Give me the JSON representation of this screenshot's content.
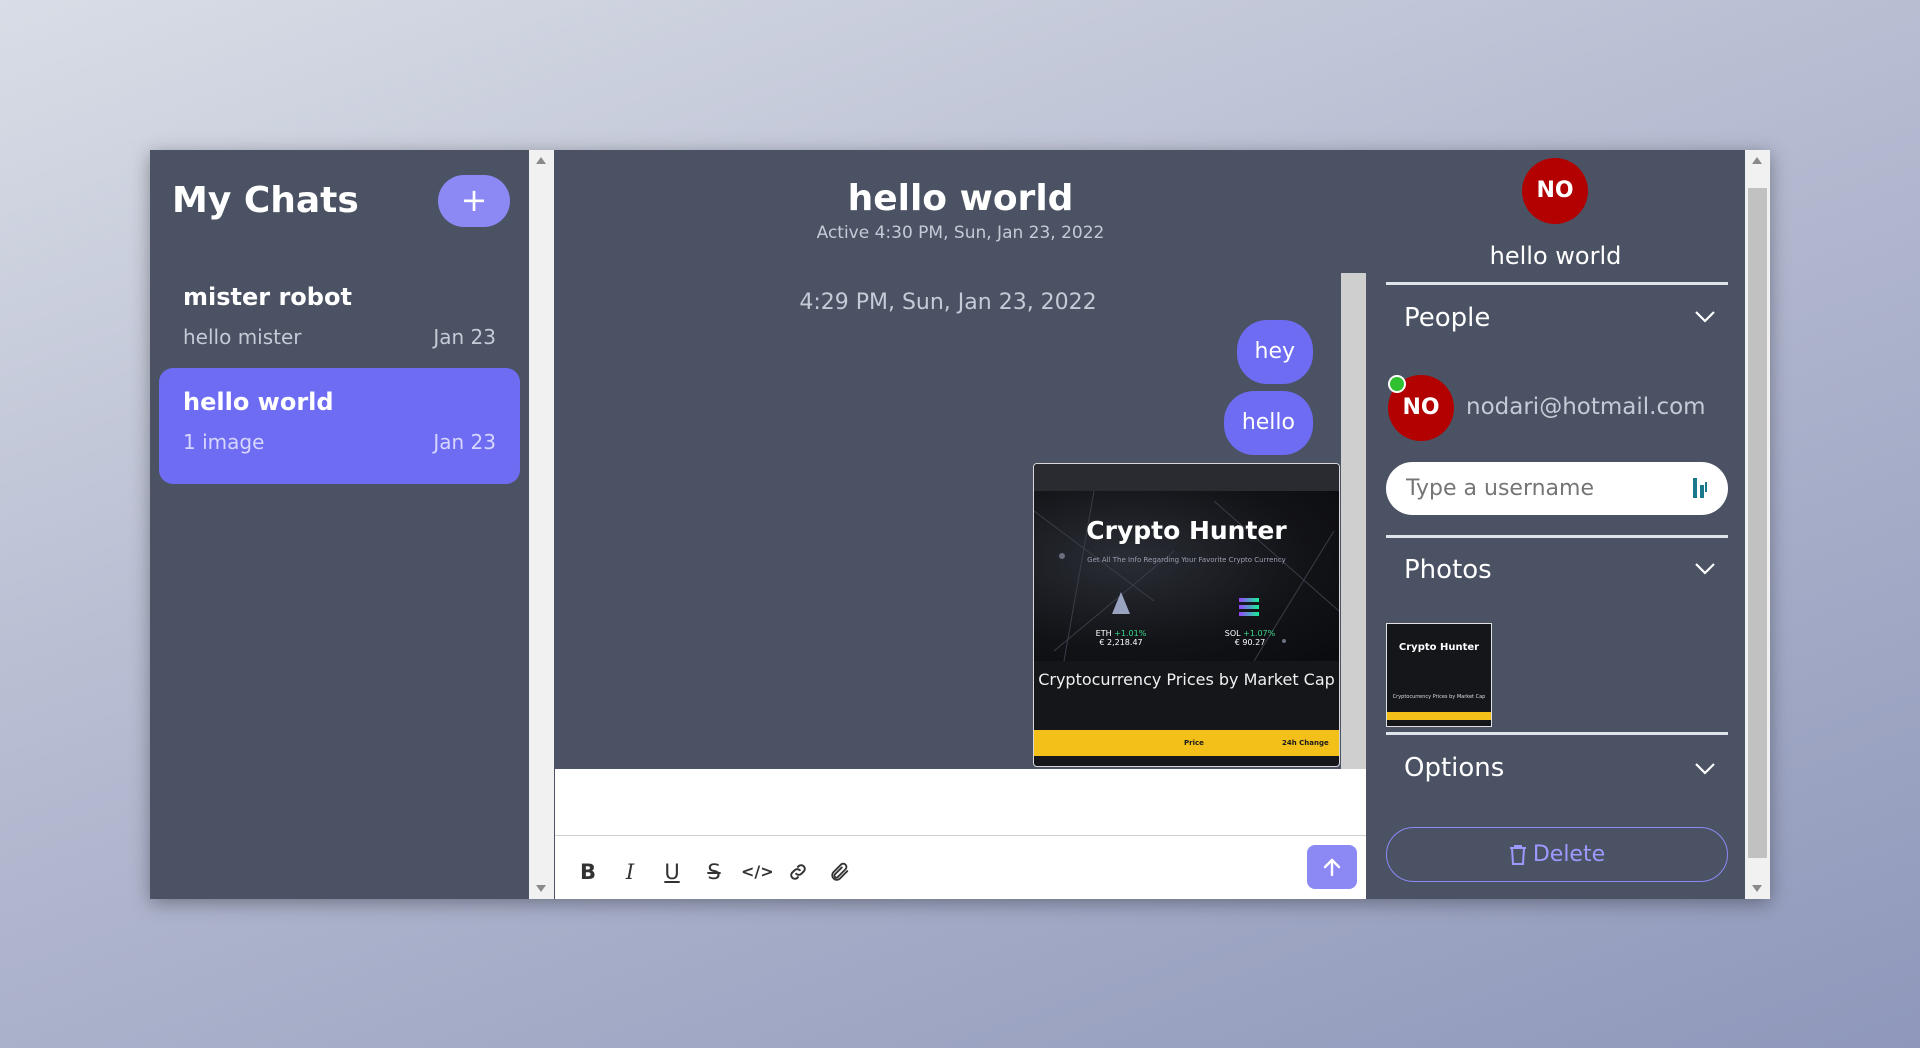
{
  "sidebar": {
    "title": "My Chats",
    "new_chat_label": "+",
    "chats": [
      {
        "name": "mister robot",
        "preview": "hello mister",
        "date": "Jan 23",
        "active": false
      },
      {
        "name": "hello world",
        "preview": "1 image",
        "date": "Jan 23",
        "active": true
      }
    ]
  },
  "chat": {
    "title": "hello world",
    "active_status": "Active 4:30 PM, Sun, Jan 23, 2022",
    "timestamp": "4:29 PM, Sun, Jan 23, 2022",
    "messages": [
      {
        "text": "hey"
      },
      {
        "text": "hello"
      }
    ],
    "image_message": {
      "title": "Crypto Hunter",
      "subtitle": "Get All The Info Regarding Your Favorite Crypto Currency",
      "coins": [
        {
          "symbol": "ETH",
          "change": "+1.01%",
          "price": "€ 2,218.47"
        },
        {
          "symbol": "SOL",
          "change": "+1.07%",
          "price": "€ 90.27"
        }
      ],
      "caption": "Cryptocurrency Prices by Market Cap",
      "bar_labels": [
        "Price",
        "24h Change"
      ]
    }
  },
  "composer": {
    "tools": [
      "bold-icon",
      "italic-icon",
      "underline-icon",
      "strikethrough-icon",
      "code-icon",
      "link-icon",
      "attachment-icon"
    ],
    "accent_color": "#8c89f5"
  },
  "settings": {
    "avatar_initials": "NO",
    "chat_name": "hello world",
    "people": {
      "title": "People",
      "members": [
        {
          "initials": "NO",
          "email": "nodari@hotmail.com",
          "online": true
        }
      ],
      "input_placeholder": "Type a username"
    },
    "photos": {
      "title": "Photos",
      "thumb_title": "Crypto Hunter",
      "thumb_caption": "Cryptocurrency Prices by Market Cap"
    },
    "options": {
      "title": "Options",
      "delete_label": "Delete"
    }
  },
  "colors": {
    "panel": "#4a5263",
    "accent": "#6e6cf3",
    "avatar": "#b30000"
  }
}
